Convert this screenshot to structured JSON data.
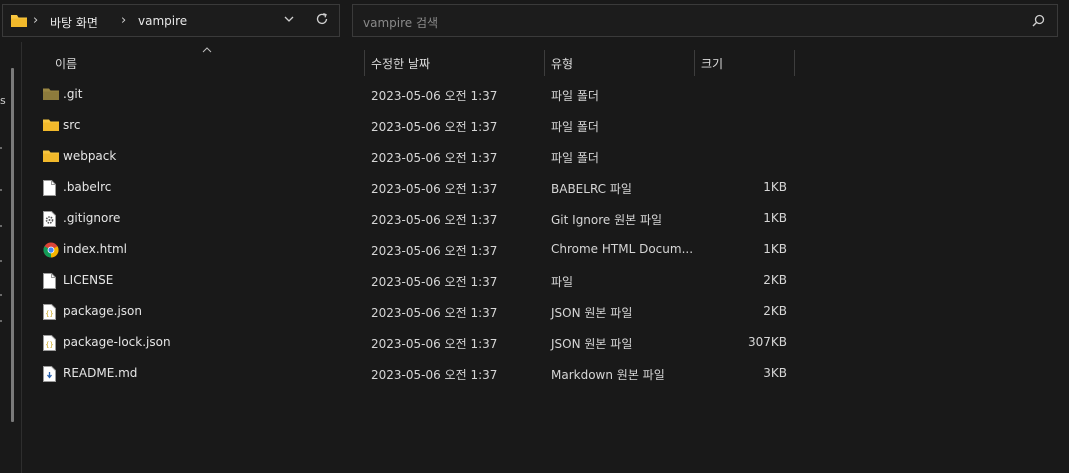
{
  "address": {
    "crumbs": [
      "바탕 화면",
      "vampire"
    ]
  },
  "search": {
    "placeholder": "vampire 검색"
  },
  "leftpane": {
    "label": "s"
  },
  "columns": {
    "name": "이름",
    "date": "수정한 날짜",
    "type": "유형",
    "size": "크기"
  },
  "files": [
    {
      "name": ".git",
      "date": "2023-05-06 오전 1:37",
      "type": "파일 폴더",
      "size": "",
      "icon": "folder-dark-icon"
    },
    {
      "name": "src",
      "date": "2023-05-06 오전 1:37",
      "type": "파일 폴더",
      "size": "",
      "icon": "folder-icon"
    },
    {
      "name": "webpack",
      "date": "2023-05-06 오전 1:37",
      "type": "파일 폴더",
      "size": "",
      "icon": "folder-icon"
    },
    {
      "name": ".babelrc",
      "date": "2023-05-06 오전 1:37",
      "type": "BABELRC 파일",
      "size": "1KB",
      "icon": "file-icon"
    },
    {
      "name": ".gitignore",
      "date": "2023-05-06 오전 1:37",
      "type": "Git Ignore 원본 파일",
      "size": "1KB",
      "icon": "gear-file-icon"
    },
    {
      "name": "index.html",
      "date": "2023-05-06 오전 1:37",
      "type": "Chrome HTML Docum...",
      "size": "1KB",
      "icon": "chrome-icon"
    },
    {
      "name": "LICENSE",
      "date": "2023-05-06 오전 1:37",
      "type": "파일",
      "size": "2KB",
      "icon": "file-icon"
    },
    {
      "name": "package.json",
      "date": "2023-05-06 오전 1:37",
      "type": "JSON 원본 파일",
      "size": "2KB",
      "icon": "json-file-icon"
    },
    {
      "name": "package-lock.json",
      "date": "2023-05-06 오전 1:37",
      "type": "JSON 원본 파일",
      "size": "307KB",
      "icon": "json-file-icon"
    },
    {
      "name": "README.md",
      "date": "2023-05-06 오전 1:37",
      "type": "Markdown 원본 파일",
      "size": "3KB",
      "icon": "markdown-file-icon"
    }
  ],
  "colors": {
    "folder": "#f8c640",
    "folder_dark": "#8d7b3c",
    "background": "#191919"
  }
}
